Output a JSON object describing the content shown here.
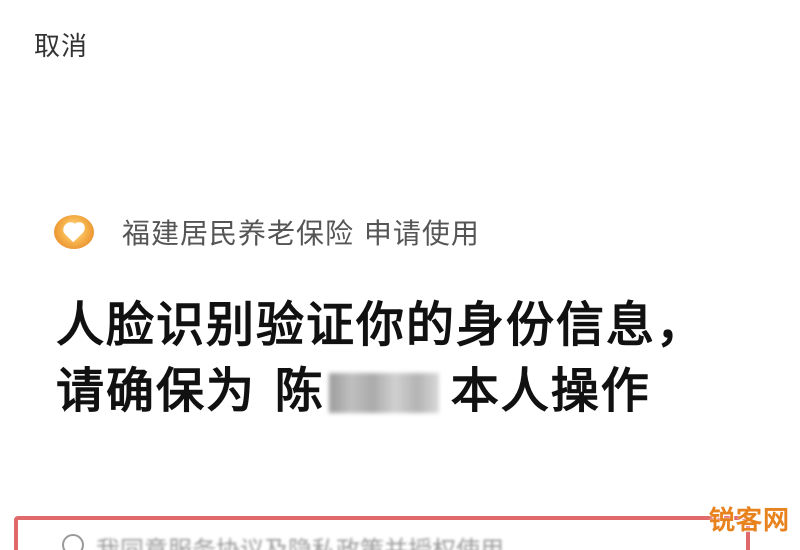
{
  "top_bar": {
    "cancel_label": "取消"
  },
  "app": {
    "logo_icon": "heart-badge-icon",
    "logo_color": "#f6b24a",
    "name": "福建居民养老保险",
    "request_text": "申请使用"
  },
  "headline": {
    "line1": "人脸识别验证你的身份信息，",
    "line2_prefix": "请确保为 陈",
    "line2_suffix": "本人操作"
  },
  "agreement": {
    "text": "我同意服务协议及隐私政策并授权使用"
  },
  "watermark": {
    "text": "锐客网"
  },
  "colors": {
    "highlight_border": "#e06a6a",
    "watermark": "#e8821d"
  }
}
